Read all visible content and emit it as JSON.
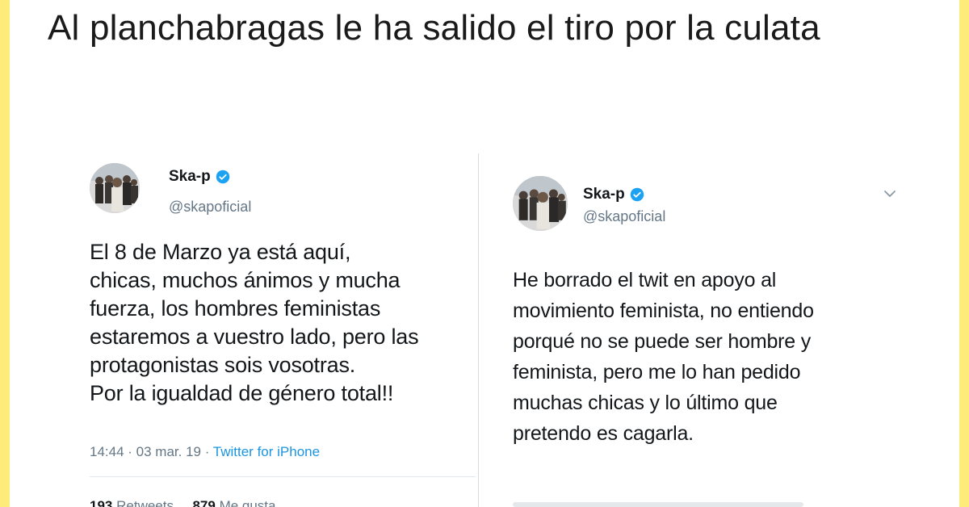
{
  "headline": "Al planchabragas le ha salido el tiro por la culata",
  "colors": {
    "border": "#fdeb7a",
    "link_blue": "#1b95e0",
    "verified_blue": "#1da1f2",
    "muted_gray": "#657786"
  },
  "tweets": [
    {
      "name": "Ska-p",
      "handle": "@skapoficial",
      "verified_icon": "verified-badge-icon",
      "text": "El 8 de Marzo ya está aquí,\nchicas, muchos ánimos y mucha\nfuerza, los hombres feministas\nestaremos a vuestro lado, pero las\nprotagonistas sois vosotras.\nPor la igualdad de género total!!",
      "timestamp": "14:44 · 03 mar. 19 · ",
      "source": "Twitter for iPhone",
      "retweets_count": "193",
      "retweets_label": "Retweets",
      "likes_count": "879",
      "likes_label": "Me gusta"
    },
    {
      "name": "Ska-p",
      "handle": "@skapoficial",
      "verified_icon": "verified-badge-icon",
      "menu_icon": "chevron-down-icon",
      "text": "He borrado el twit en apoyo al\nmovimiento feminista, no entiendo\nporqué no se puede ser hombre y\nfeminista, pero me lo han pedido\nmuchas chicas y lo último que\npretendo es cagarla."
    }
  ]
}
